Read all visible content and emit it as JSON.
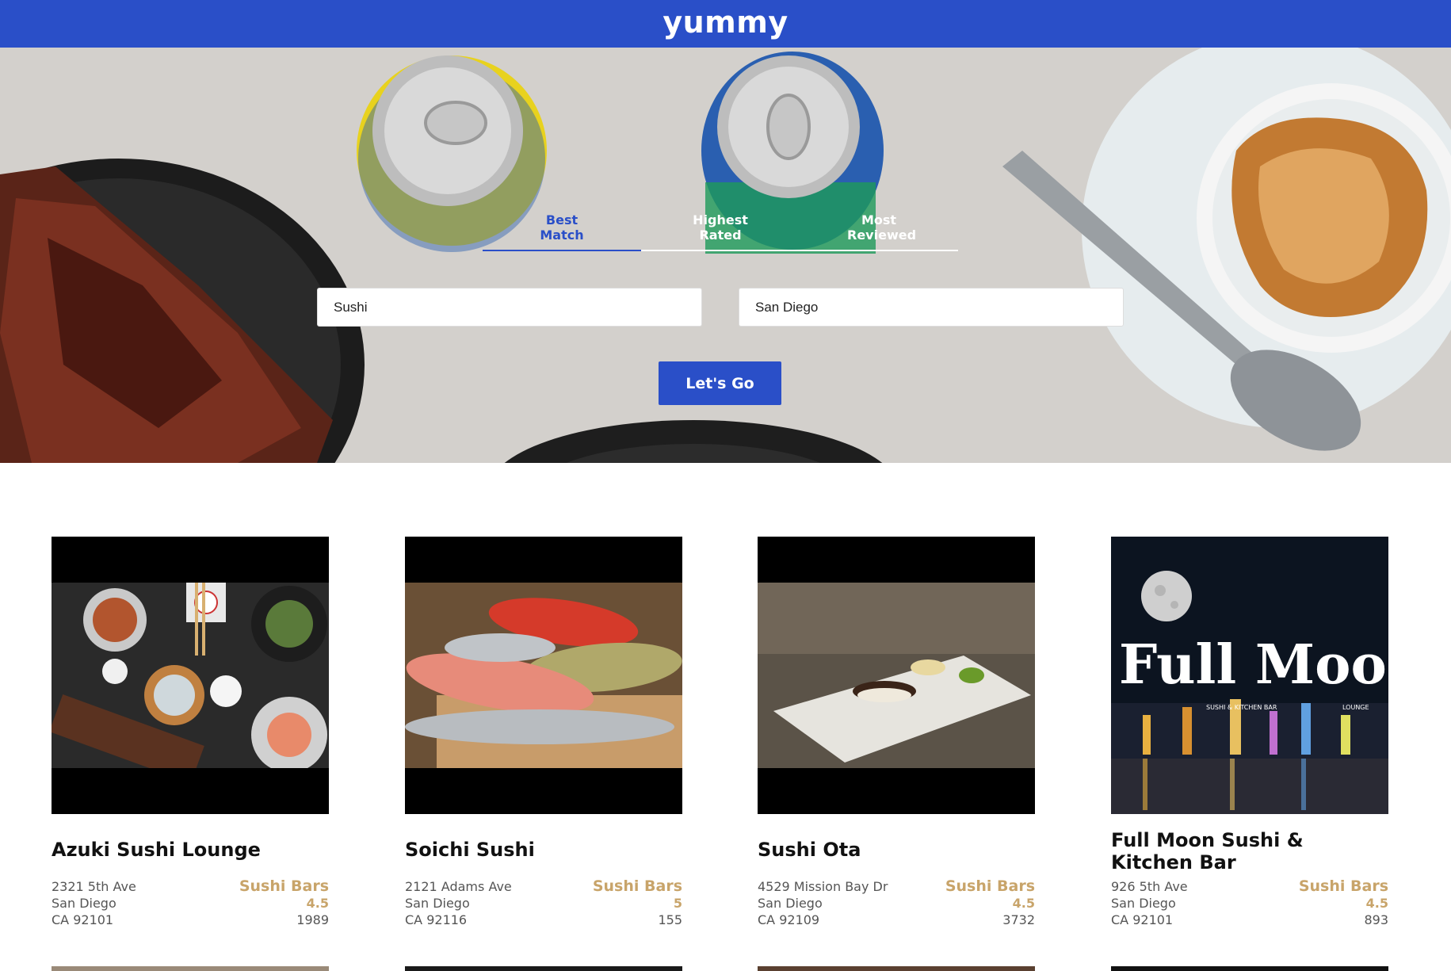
{
  "header": {
    "logo": "yummy"
  },
  "tabs": [
    {
      "label": "Best Match",
      "active": true
    },
    {
      "label": "Highest Rated",
      "active": false
    },
    {
      "label": "Most Reviewed",
      "active": false
    }
  ],
  "search": {
    "term_value": "Sushi",
    "location_value": "San Diego",
    "button_label": "Let's Go"
  },
  "businesses": [
    {
      "name": "Azuki Sushi Lounge",
      "address": "2321 5th Ave",
      "city": "San Diego",
      "state_zip": "CA 92101",
      "category": "Sushi Bars",
      "rating": "4.5",
      "review_count": "1989"
    },
    {
      "name": "Soichi Sushi",
      "address": "2121 Adams Ave",
      "city": "San Diego",
      "state_zip": "CA 92116",
      "category": "Sushi Bars",
      "rating": "5",
      "review_count": "155"
    },
    {
      "name": "Sushi Ota",
      "address": "4529 Mission Bay Dr",
      "city": "San Diego",
      "state_zip": "CA 92109",
      "category": "Sushi Bars",
      "rating": "4.5",
      "review_count": "3732"
    },
    {
      "name": "Full Moon Sushi & Kitchen Bar",
      "address": "926 5th Ave",
      "city": "San Diego",
      "state_zip": "CA 92101",
      "category": "Sushi Bars",
      "rating": "4.5",
      "review_count": "893",
      "logo_text": "Full Moon",
      "logo_subtext_left": "SUSHI & KITCHEN BAR",
      "logo_subtext_right": "LOUNGE"
    }
  ],
  "colors": {
    "brand": "#2a4fc8",
    "accent": "#c8a46a"
  }
}
